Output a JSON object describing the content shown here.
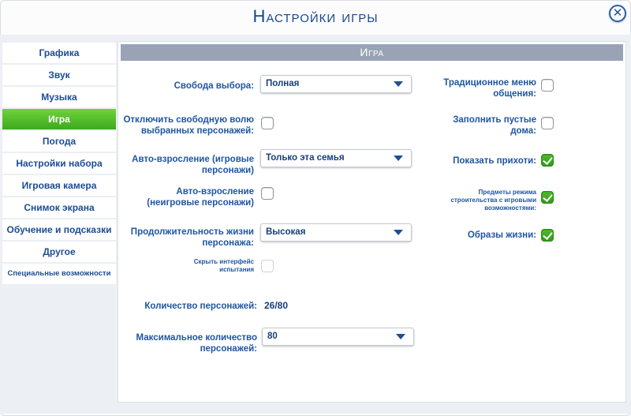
{
  "window": {
    "title": "Настройки игры",
    "close_glyph": "✕"
  },
  "sidebar": {
    "items": [
      {
        "label": "Графика",
        "active": false
      },
      {
        "label": "Звук",
        "active": false
      },
      {
        "label": "Музыка",
        "active": false
      },
      {
        "label": "Игра",
        "active": true
      },
      {
        "label": "Погода",
        "active": false
      },
      {
        "label": "Настройки набора",
        "active": false
      },
      {
        "label": "Игровая камера",
        "active": false
      },
      {
        "label": "Снимок экрана",
        "active": false
      },
      {
        "label": "Обучение и подсказки",
        "active": false
      },
      {
        "label": "Другое",
        "active": false
      },
      {
        "label": "Специальные возможности",
        "active": false
      }
    ]
  },
  "panel": {
    "header": "Игра"
  },
  "settings": {
    "free_will": {
      "label": "Свобода выбора:",
      "value": "Полная"
    },
    "disable_free_will": {
      "label_line1": "Отключить свободную волю",
      "label_line2": "выбранных персонажей:",
      "checked": false
    },
    "auto_age_played": {
      "label_line1": "Авто-взросление (игровые",
      "label_line2": "персонажи)",
      "value": "Только эта семья"
    },
    "auto_age_unplayed": {
      "label_line1": "Авто-взросление",
      "label_line2": "(неигровые персонажи)",
      "checked": false
    },
    "lifespan": {
      "label_line1": "Продолжительность жизни",
      "label_line2": "персонажа:",
      "value": "Высокая"
    },
    "hide_challenge_ui": {
      "label_line1": "Скрыть интерфейс",
      "label_line2": "испытания",
      "checked": false,
      "disabled": true
    },
    "sim_count": {
      "label": "Количество персонажей:",
      "value": "26/80"
    },
    "max_sims": {
      "label_line1": "Максимальное количество",
      "label_line2": "персонажей:",
      "value": "80"
    },
    "traditional_menu": {
      "label_line1": "Традиционное меню",
      "label_line2": "общения:",
      "checked": false
    },
    "fill_empty_houses": {
      "label_line1": "Заполнить пустые",
      "label_line2": "дома:",
      "checked": false
    },
    "show_whims": {
      "label": "Показать прихоти:",
      "checked": true
    },
    "build_mode_items": {
      "label_line1": "Предметы режима",
      "label_line2": "строительства с игровыми",
      "label_line3": "возможностями:",
      "checked": true
    },
    "lifestyles": {
      "label": "Образы жизни:",
      "checked": true
    }
  },
  "colors": {
    "accent_green": "#3ea81d",
    "text_blue": "#1f56a0",
    "header_grey": "#9aa3b6"
  }
}
